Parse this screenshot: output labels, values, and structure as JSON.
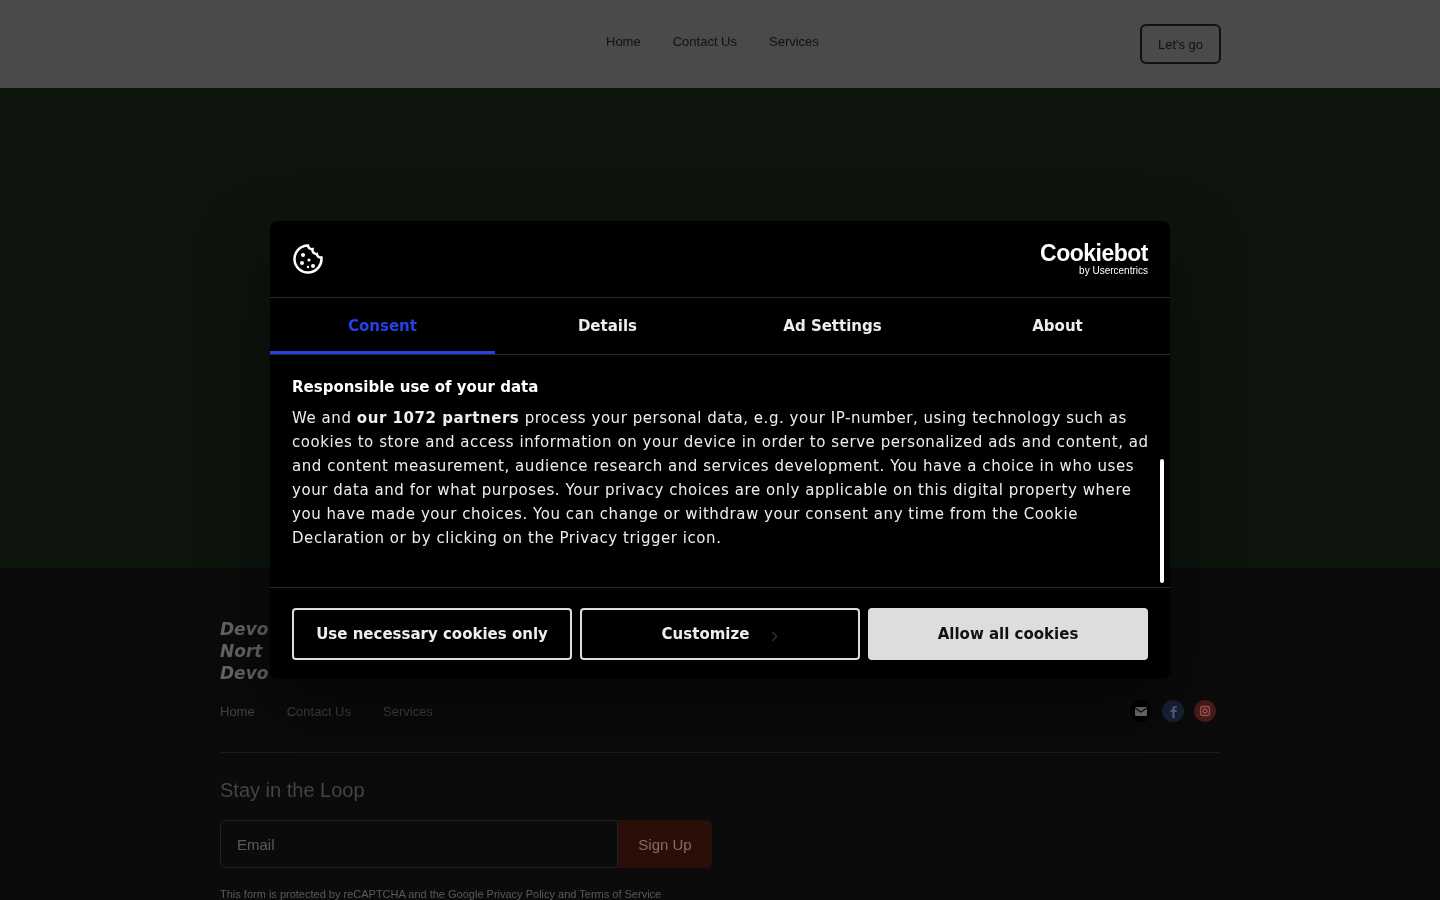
{
  "header": {
    "nav": [
      "Home",
      "Contact Us",
      "Services"
    ],
    "cta": "Let's go"
  },
  "footer": {
    "logo_lines": [
      "Devo",
      "Nort",
      "Devo"
    ],
    "nav": [
      "Home",
      "Contact Us",
      "Services"
    ],
    "social": [
      {
        "kind": "email",
        "color": "#000000"
      },
      {
        "kind": "facebook",
        "color": "#1a2238"
      },
      {
        "kind": "instagram",
        "color": "#4a1a1a"
      }
    ],
    "newsletter_title": "Stay in the Loop",
    "email_placeholder": "Email",
    "signup": "Sign Up",
    "legal": "This form is protected by reCAPTCHA and the Google Privacy Policy and Terms of Service"
  },
  "dialog": {
    "brand": "Cookiebot",
    "brand_sub": "by Usercentrics",
    "tabs": [
      {
        "label": "Consent",
        "selected": true
      },
      {
        "label": "Details",
        "selected": false
      },
      {
        "label": "Ad Settings",
        "selected": false
      },
      {
        "label": "About",
        "selected": false
      }
    ],
    "heading": "Responsible use of your data",
    "body": "We and **our 1072 partners** process your personal data, e.g. your IP-number, using technology such as cookies to store and access information on your device in order to serve personalized ads and content, ad and content measurement, audience research and services development. You have a choice in who uses your data and for what purposes. Your privacy choices are only applicable on this digital property where you have made your choices. You can change or withdraw your consent any time from the Cookie Declaration or by clicking on the Privacy trigger icon.",
    "buttons": [
      {
        "label": "Use necessary cookies only",
        "kind": "outline"
      },
      {
        "label": "Customize",
        "kind": "chevron"
      },
      {
        "label": "Allow all cookies",
        "kind": "filled"
      }
    ]
  }
}
